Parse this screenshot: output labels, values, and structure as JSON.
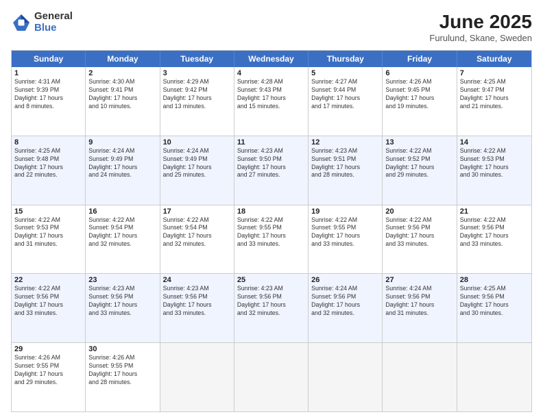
{
  "logo": {
    "general": "General",
    "blue": "Blue"
  },
  "title": "June 2025",
  "location": "Furulund, Skane, Sweden",
  "header_days": [
    "Sunday",
    "Monday",
    "Tuesday",
    "Wednesday",
    "Thursday",
    "Friday",
    "Saturday"
  ],
  "rows": [
    [
      {
        "day": "1",
        "lines": [
          "Sunrise: 4:31 AM",
          "Sunset: 9:39 PM",
          "Daylight: 17 hours",
          "and 8 minutes."
        ]
      },
      {
        "day": "2",
        "lines": [
          "Sunrise: 4:30 AM",
          "Sunset: 9:41 PM",
          "Daylight: 17 hours",
          "and 10 minutes."
        ]
      },
      {
        "day": "3",
        "lines": [
          "Sunrise: 4:29 AM",
          "Sunset: 9:42 PM",
          "Daylight: 17 hours",
          "and 13 minutes."
        ]
      },
      {
        "day": "4",
        "lines": [
          "Sunrise: 4:28 AM",
          "Sunset: 9:43 PM",
          "Daylight: 17 hours",
          "and 15 minutes."
        ]
      },
      {
        "day": "5",
        "lines": [
          "Sunrise: 4:27 AM",
          "Sunset: 9:44 PM",
          "Daylight: 17 hours",
          "and 17 minutes."
        ]
      },
      {
        "day": "6",
        "lines": [
          "Sunrise: 4:26 AM",
          "Sunset: 9:45 PM",
          "Daylight: 17 hours",
          "and 19 minutes."
        ]
      },
      {
        "day": "7",
        "lines": [
          "Sunrise: 4:25 AM",
          "Sunset: 9:47 PM",
          "Daylight: 17 hours",
          "and 21 minutes."
        ]
      }
    ],
    [
      {
        "day": "8",
        "lines": [
          "Sunrise: 4:25 AM",
          "Sunset: 9:48 PM",
          "Daylight: 17 hours",
          "and 22 minutes."
        ]
      },
      {
        "day": "9",
        "lines": [
          "Sunrise: 4:24 AM",
          "Sunset: 9:49 PM",
          "Daylight: 17 hours",
          "and 24 minutes."
        ]
      },
      {
        "day": "10",
        "lines": [
          "Sunrise: 4:24 AM",
          "Sunset: 9:49 PM",
          "Daylight: 17 hours",
          "and 25 minutes."
        ]
      },
      {
        "day": "11",
        "lines": [
          "Sunrise: 4:23 AM",
          "Sunset: 9:50 PM",
          "Daylight: 17 hours",
          "and 27 minutes."
        ]
      },
      {
        "day": "12",
        "lines": [
          "Sunrise: 4:23 AM",
          "Sunset: 9:51 PM",
          "Daylight: 17 hours",
          "and 28 minutes."
        ]
      },
      {
        "day": "13",
        "lines": [
          "Sunrise: 4:22 AM",
          "Sunset: 9:52 PM",
          "Daylight: 17 hours",
          "and 29 minutes."
        ]
      },
      {
        "day": "14",
        "lines": [
          "Sunrise: 4:22 AM",
          "Sunset: 9:53 PM",
          "Daylight: 17 hours",
          "and 30 minutes."
        ]
      }
    ],
    [
      {
        "day": "15",
        "lines": [
          "Sunrise: 4:22 AM",
          "Sunset: 9:53 PM",
          "Daylight: 17 hours",
          "and 31 minutes."
        ]
      },
      {
        "day": "16",
        "lines": [
          "Sunrise: 4:22 AM",
          "Sunset: 9:54 PM",
          "Daylight: 17 hours",
          "and 32 minutes."
        ]
      },
      {
        "day": "17",
        "lines": [
          "Sunrise: 4:22 AM",
          "Sunset: 9:54 PM",
          "Daylight: 17 hours",
          "and 32 minutes."
        ]
      },
      {
        "day": "18",
        "lines": [
          "Sunrise: 4:22 AM",
          "Sunset: 9:55 PM",
          "Daylight: 17 hours",
          "and 33 minutes."
        ]
      },
      {
        "day": "19",
        "lines": [
          "Sunrise: 4:22 AM",
          "Sunset: 9:55 PM",
          "Daylight: 17 hours",
          "and 33 minutes."
        ]
      },
      {
        "day": "20",
        "lines": [
          "Sunrise: 4:22 AM",
          "Sunset: 9:56 PM",
          "Daylight: 17 hours",
          "and 33 minutes."
        ]
      },
      {
        "day": "21",
        "lines": [
          "Sunrise: 4:22 AM",
          "Sunset: 9:56 PM",
          "Daylight: 17 hours",
          "and 33 minutes."
        ]
      }
    ],
    [
      {
        "day": "22",
        "lines": [
          "Sunrise: 4:22 AM",
          "Sunset: 9:56 PM",
          "Daylight: 17 hours",
          "and 33 minutes."
        ]
      },
      {
        "day": "23",
        "lines": [
          "Sunrise: 4:23 AM",
          "Sunset: 9:56 PM",
          "Daylight: 17 hours",
          "and 33 minutes."
        ]
      },
      {
        "day": "24",
        "lines": [
          "Sunrise: 4:23 AM",
          "Sunset: 9:56 PM",
          "Daylight: 17 hours",
          "and 33 minutes."
        ]
      },
      {
        "day": "25",
        "lines": [
          "Sunrise: 4:23 AM",
          "Sunset: 9:56 PM",
          "Daylight: 17 hours",
          "and 32 minutes."
        ]
      },
      {
        "day": "26",
        "lines": [
          "Sunrise: 4:24 AM",
          "Sunset: 9:56 PM",
          "Daylight: 17 hours",
          "and 32 minutes."
        ]
      },
      {
        "day": "27",
        "lines": [
          "Sunrise: 4:24 AM",
          "Sunset: 9:56 PM",
          "Daylight: 17 hours",
          "and 31 minutes."
        ]
      },
      {
        "day": "28",
        "lines": [
          "Sunrise: 4:25 AM",
          "Sunset: 9:56 PM",
          "Daylight: 17 hours",
          "and 30 minutes."
        ]
      }
    ],
    [
      {
        "day": "29",
        "lines": [
          "Sunrise: 4:26 AM",
          "Sunset: 9:55 PM",
          "Daylight: 17 hours",
          "and 29 minutes."
        ]
      },
      {
        "day": "30",
        "lines": [
          "Sunrise: 4:26 AM",
          "Sunset: 9:55 PM",
          "Daylight: 17 hours",
          "and 28 minutes."
        ]
      },
      {
        "day": "",
        "lines": []
      },
      {
        "day": "",
        "lines": []
      },
      {
        "day": "",
        "lines": []
      },
      {
        "day": "",
        "lines": []
      },
      {
        "day": "",
        "lines": []
      }
    ]
  ]
}
